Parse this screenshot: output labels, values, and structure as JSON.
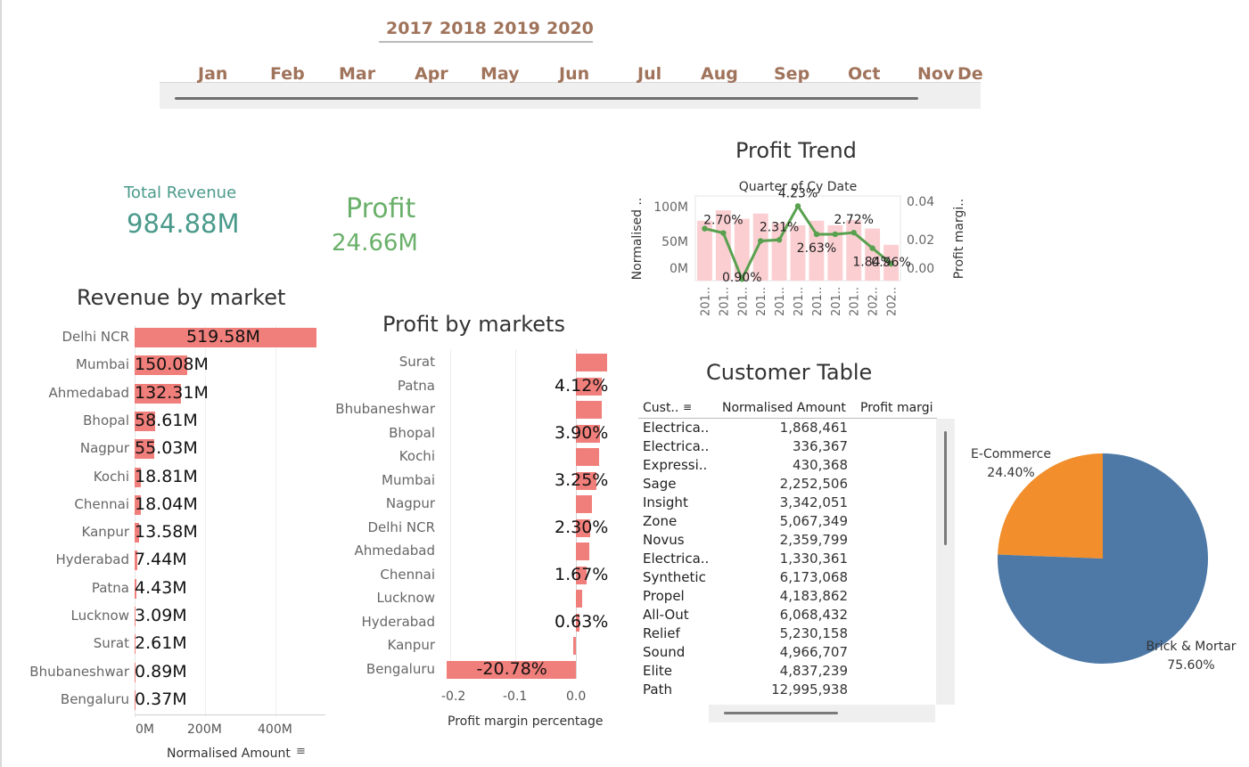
{
  "filters": {
    "years": [
      "2017",
      "2018",
      "2019",
      "2020"
    ],
    "months": [
      "Jan",
      "Feb",
      "Mar",
      "Apr",
      "May",
      "Jun",
      "Jul",
      "Aug",
      "Sep",
      "Oct",
      "Nov",
      "De"
    ]
  },
  "kpis": {
    "revenue_label": "Total Revenue",
    "revenue_value": "984.88M",
    "profit_label": "Profit",
    "profit_value": "24.66M"
  },
  "sections": {
    "revenue_title": "Revenue by market",
    "profit_title": "Profit by markets",
    "trend_title": "Profit Trend",
    "customer_title": "Customer Table"
  },
  "chart_data": [
    {
      "type": "bar",
      "orientation": "horizontal",
      "title": "Revenue by market",
      "xlabel": "Normalised Amount",
      "ylabel": "",
      "xlim": [
        0,
        520000000
      ],
      "x_ticks": [
        "0M",
        "200M",
        "400M"
      ],
      "categories": [
        "Delhi NCR",
        "Mumbai",
        "Ahmedabad",
        "Bhopal",
        "Nagpur",
        "Kochi",
        "Chennai",
        "Kanpur",
        "Hyderabad",
        "Patna",
        "Lucknow",
        "Surat",
        "Bhubaneshwar",
        "Bengaluru"
      ],
      "values": [
        519.58,
        150.08,
        132.31,
        58.61,
        55.03,
        18.81,
        18.04,
        13.58,
        7.44,
        4.43,
        3.09,
        2.61,
        0.89,
        0.37
      ],
      "data_labels": [
        "519.58M",
        "150.08M",
        "132.31M",
        "58.61M",
        "55.03M",
        "18.81M",
        "18.04M",
        "13.58M",
        "7.44M",
        "4.43M",
        "3.09M",
        "2.61M",
        "0.89M",
        "0.37M"
      ],
      "color": "#f07f7b"
    },
    {
      "type": "bar",
      "orientation": "horizontal",
      "title": "Profit by markets",
      "xlabel": "Profit margin percentage",
      "ylabel": "",
      "xlim": [
        -0.22,
        0.06
      ],
      "x_ticks": [
        "-0.2",
        "-0.1",
        "0.0"
      ],
      "categories": [
        "Surat",
        "Patna",
        "Bhubaneshwar",
        "Bhopal",
        "Kochi",
        "Mumbai",
        "Nagpur",
        "Delhi NCR",
        "Ahmedabad",
        "Chennai",
        "Lucknow",
        "Hyderabad",
        "Kanpur",
        "Bengaluru"
      ],
      "values": [
        5.0,
        4.12,
        4.1,
        3.9,
        3.7,
        3.25,
        2.6,
        2.3,
        2.2,
        1.67,
        1.0,
        0.63,
        -0.5,
        -20.78
      ],
      "data_labels": [
        "",
        "4.12%",
        "",
        "3.90%",
        "",
        "3.25%",
        "",
        "2.30%",
        "",
        "1.67%",
        "",
        "0.63%",
        "",
        "-20.78%"
      ],
      "color": "#f07f7b"
    },
    {
      "type": "bar+line",
      "title": "Profit Trend",
      "top_axis_label": "Quarter of Cy Date",
      "ylabel": "Normalised ..",
      "y2label": "Profit margi..",
      "y_ticks": [
        "100M",
        "50M",
        "0M"
      ],
      "y2_ticks": [
        "0.04",
        "0.02",
        "0.00"
      ],
      "ylim": [
        0,
        130000000
      ],
      "y2lim": [
        0,
        0.048
      ],
      "categories": [
        "201..",
        "201..",
        "201..",
        "201..",
        "201..",
        "201..",
        "201..",
        "201..",
        "201..",
        "202..",
        "202.."
      ],
      "bars": [
        92,
        108,
        95,
        103,
        88,
        85,
        92,
        85,
        93,
        80,
        55
      ],
      "line": [
        0.0295,
        0.027,
        0.0009,
        0.0225,
        0.0231,
        0.0423,
        0.0263,
        0.0263,
        0.0272,
        0.0184,
        0.0096
      ],
      "line_labels": [
        "",
        "2.70%",
        "0.90%",
        "",
        "2.31%",
        "4.23%",
        "2.63%",
        "",
        "2.72%",
        "1.84%",
        "0.96%"
      ],
      "bar_color": "#fbcfd2",
      "line_color": "#59a14f"
    },
    {
      "type": "pie",
      "title": "",
      "labels": [
        "E-Commerce",
        "Brick & Mortar"
      ],
      "values": [
        24.4,
        75.6
      ],
      "value_labels": [
        "24.40%",
        "75.60%"
      ],
      "colors": [
        "#f28e2b",
        "#4e79a7"
      ]
    }
  ],
  "customer_table": {
    "headers": [
      "Cust..",
      "Normalised Amount",
      "Profit margi"
    ],
    "rows": [
      {
        "name": "Electrica..",
        "amount": "1,868,461"
      },
      {
        "name": "Electrica..",
        "amount": "336,367"
      },
      {
        "name": "Expressi..",
        "amount": "430,368"
      },
      {
        "name": "Sage",
        "amount": "2,252,506"
      },
      {
        "name": "Insight",
        "amount": "3,342,051"
      },
      {
        "name": "Zone",
        "amount": "5,067,349"
      },
      {
        "name": "Novus",
        "amount": "2,359,799"
      },
      {
        "name": "Electrica..",
        "amount": "1,330,361"
      },
      {
        "name": "Synthetic",
        "amount": "6,173,068"
      },
      {
        "name": "Propel",
        "amount": "4,183,862"
      },
      {
        "name": "All-Out",
        "amount": "6,068,432"
      },
      {
        "name": "Relief",
        "amount": "5,230,158"
      },
      {
        "name": "Sound",
        "amount": "4,966,707"
      },
      {
        "name": "Elite",
        "amount": "4,837,239"
      },
      {
        "name": "Path",
        "amount": "12,995,938"
      }
    ]
  }
}
